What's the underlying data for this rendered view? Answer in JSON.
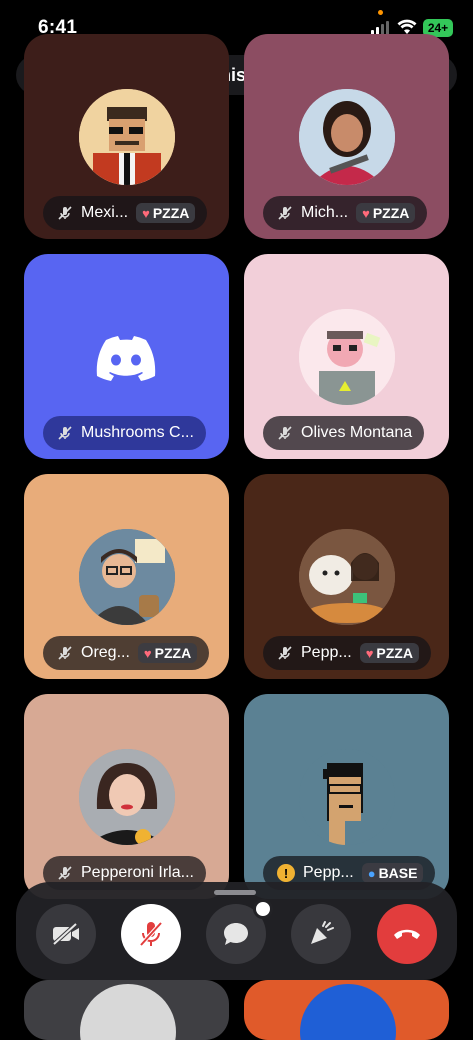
{
  "status_bar": {
    "time": "6:41",
    "battery": "24+"
  },
  "header": {
    "channel_emoji": "🌎",
    "channel_name": "LATAM (Spanish)",
    "chevron": "›"
  },
  "tiles": [
    {
      "name": "Mexi...",
      "badge": "PZZA",
      "color": "#3d1e1a"
    },
    {
      "name": "Mich...",
      "badge": "PZZA",
      "color": "#8c4d62"
    },
    {
      "name": "Mushrooms C...",
      "badge": "",
      "color": "#5865f2"
    },
    {
      "name": "Olives Montana",
      "badge": "",
      "color": "#f2cfd9"
    },
    {
      "name": "Oreg...",
      "badge": "PZZA",
      "color": "#e8ac7a"
    },
    {
      "name": "Pepp...",
      "badge": "PZZA",
      "color": "#4a2718"
    },
    {
      "name": "Pepperoni Irla...",
      "badge": "",
      "color": "#d7a994"
    },
    {
      "name": "Pepp...",
      "badge": "BASE",
      "color": "#5b8193"
    }
  ],
  "icons": {
    "back": "chevron-down-icon",
    "speaker": "speaker-icon",
    "invite": "add-person-icon",
    "camera": "camera-off-icon",
    "mic": "mic-off-icon",
    "chat": "chat-bubble-icon",
    "soundboard": "soundboard-icon",
    "leave": "hang-up-icon"
  },
  "colors": {
    "blurple": "#5865f2",
    "danger": "#e23d3d",
    "dock": "#222226"
  }
}
